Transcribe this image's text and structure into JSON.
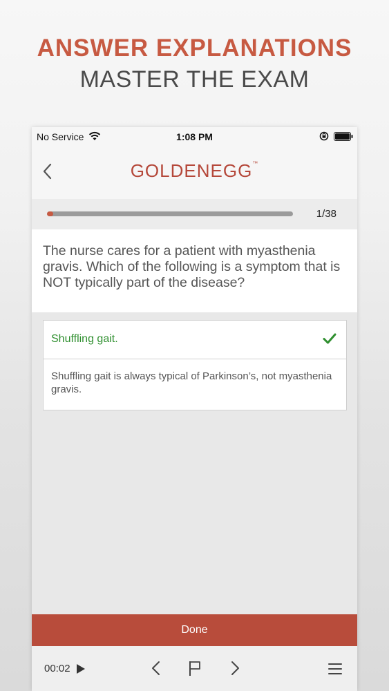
{
  "promo": {
    "title": "ANSWER EXPLANATIONS",
    "subtitle": "MASTER THE EXAM"
  },
  "status_bar": {
    "carrier": "No Service",
    "time": "1:08 PM"
  },
  "nav": {
    "logo_text": "GOLDENEGG",
    "logo_tm": "™"
  },
  "progress": {
    "current": 1,
    "total": 38,
    "label": "1/38",
    "fraction": 0.026
  },
  "question": {
    "text": "The nurse cares for a patient with myasthenia gravis. Which of the following is a symptom that is NOT typically part of the disease?"
  },
  "answer": {
    "text": "Shuffling gait.",
    "correct": true,
    "explanation": "Shuffling gait is always typical of Parkinson’s, not myasthenia gravis."
  },
  "done_label": "Done",
  "toolbar": {
    "timer": "00:02"
  },
  "colors": {
    "accent": "#c75a42",
    "button": "#b84c3b",
    "correct": "#2f8f2f"
  }
}
